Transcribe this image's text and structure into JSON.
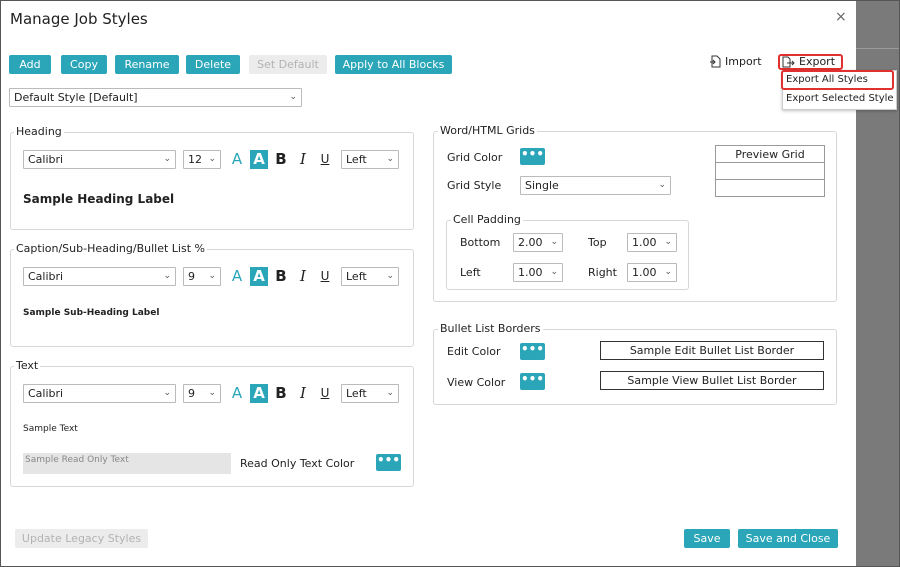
{
  "dialog": {
    "title": "Manage Job Styles",
    "close_icon": "×"
  },
  "toolbar": {
    "add": "Add",
    "copy": "Copy",
    "rename": "Rename",
    "delete": "Delete",
    "set_default": "Set Default",
    "apply_all": "Apply to All Blocks",
    "import": "Import",
    "export": "Export"
  },
  "export_menu": {
    "all": "Export All Styles",
    "selected": "Export Selected Style"
  },
  "style_select": "Default Style [Default]",
  "heading": {
    "label": "Heading",
    "font": "Calibri",
    "size": "12",
    "align": "Left",
    "sample": "Sample Heading Label"
  },
  "caption": {
    "label": "Caption/Sub-Heading/Bullet List %",
    "font": "Calibri",
    "size": "9",
    "align": "Left",
    "sample": "Sample Sub-Heading Label"
  },
  "text": {
    "label": "Text",
    "font": "Calibri",
    "size": "9",
    "align": "Left",
    "sample": "Sample Text",
    "readonly_sample": "Sample Read Only Text",
    "readonly_color_label": "Read Only Text Color"
  },
  "format_glyphs": {
    "a": "A",
    "b": "B",
    "i": "I",
    "u": "U",
    "dots": "•••",
    "chev": "⌄"
  },
  "grids": {
    "label": "Word/HTML Grids",
    "grid_color": "Grid Color",
    "grid_style": "Grid Style",
    "style_value": "Single",
    "preview": "Preview Grid",
    "cell_padding": "Cell Padding",
    "bottom_label": "Bottom",
    "bottom": "2.00",
    "top_label": "Top",
    "top": "1.00",
    "left_label": "Left",
    "left": "1.00",
    "right_label": "Right",
    "right": "1.00"
  },
  "bullet": {
    "label": "Bullet List Borders",
    "edit_color": "Edit Color",
    "view_color": "View Color",
    "edit_sample": "Sample Edit Bullet List Border",
    "view_sample": "Sample View Bullet List Border"
  },
  "footer": {
    "update_legacy": "Update Legacy Styles",
    "save": "Save",
    "save_close": "Save and Close"
  },
  "colors": {
    "accent": "#2aa6b8",
    "highlight": "#e03030"
  }
}
